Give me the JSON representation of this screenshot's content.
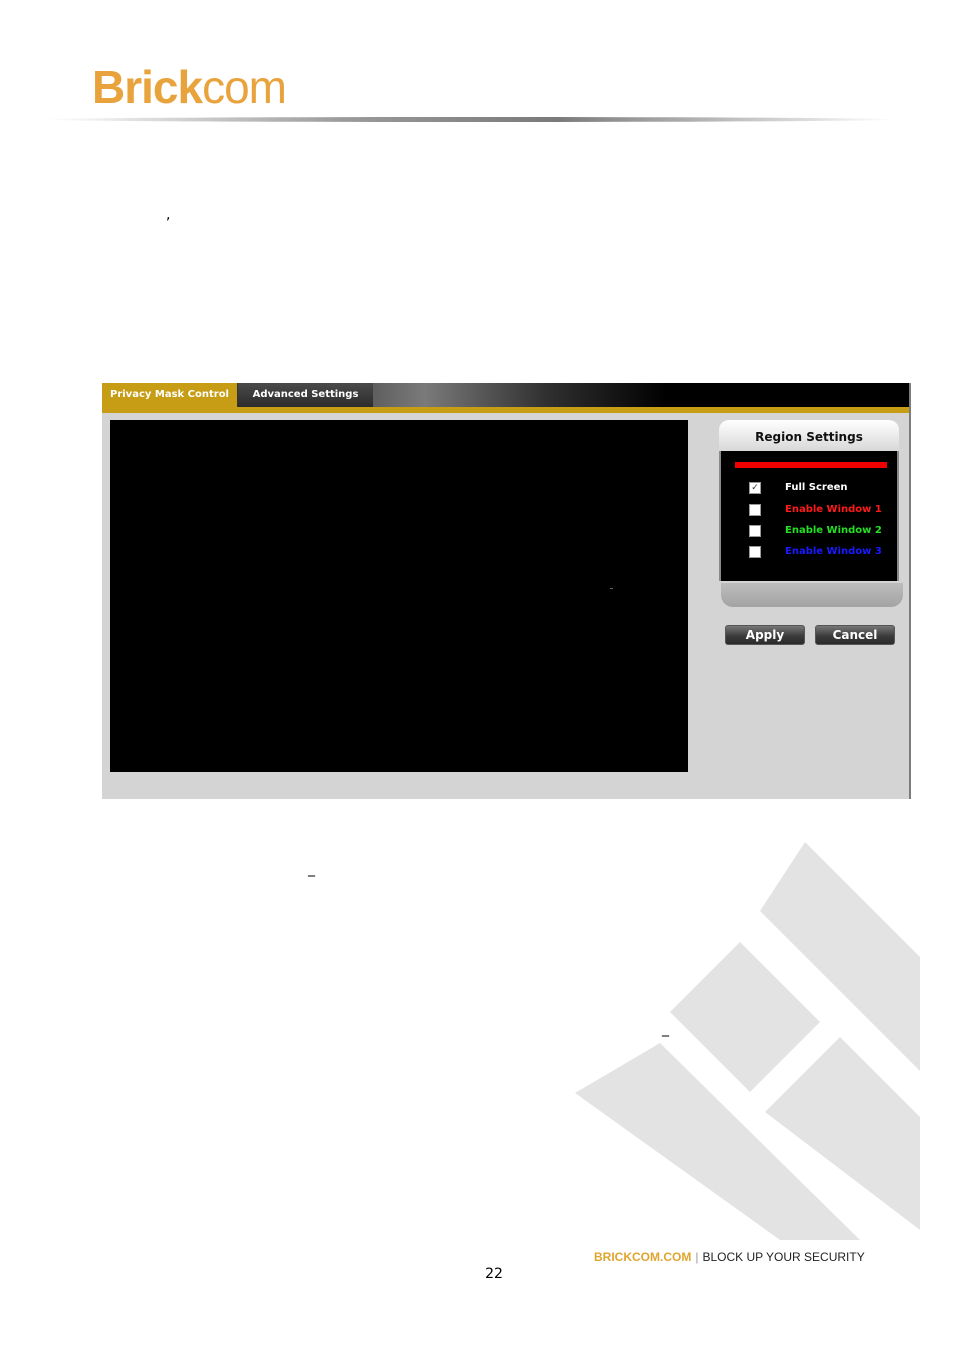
{
  "header": {
    "logo_bold": "Brick",
    "logo_light": "com"
  },
  "ui": {
    "tabs": [
      {
        "label": "Privacy Mask Control",
        "active": true
      },
      {
        "label": "Advanced Settings",
        "active": false
      }
    ],
    "region": {
      "title": "Region Settings",
      "options": [
        {
          "label": "Full Screen",
          "checked": true,
          "color": "#ffffff"
        },
        {
          "label": "Enable Window 1",
          "checked": false,
          "color": "#ff1a1a"
        },
        {
          "label": "Enable Window 2",
          "checked": false,
          "color": "#22e022"
        },
        {
          "label": "Enable Window 3",
          "checked": false,
          "color": "#1a1aff"
        }
      ],
      "checkmark": "✓"
    },
    "buttons": {
      "apply": "Apply",
      "cancel": "Cancel"
    }
  },
  "marks": {
    "comma": ",",
    "dash": "_"
  },
  "footer": {
    "site": "BRICKCOM.COM",
    "separator": "|",
    "tagline": "BLOCK UP YOUR SECURITY",
    "page_number": "22"
  },
  "colors": {
    "brand_gold": "#e8a33c",
    "tab_gold": "#c69d14",
    "decoration_gray": "#e3e3e3"
  }
}
